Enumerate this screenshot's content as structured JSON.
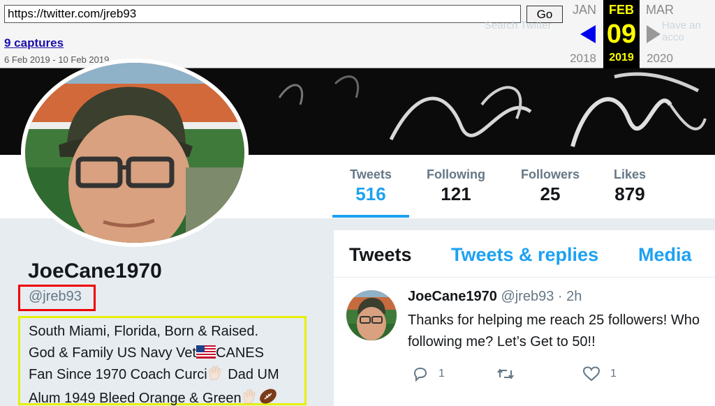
{
  "wayback": {
    "url": "https://twitter.com/jreb93",
    "go_label": "Go",
    "captures_label": "9 captures",
    "date_range": "6 Feb 2019 - 10 Feb 2019",
    "prev_month": "JAN",
    "active_month": "FEB",
    "next_month": "MAR",
    "active_day": "09",
    "prev_year": "2018",
    "active_year": "2019",
    "next_year": "2020",
    "ghost_search": "Search Twitter",
    "ghost_account": "Have an acco"
  },
  "stats": [
    {
      "label": "Tweets",
      "value": "516"
    },
    {
      "label": "Following",
      "value": "121"
    },
    {
      "label": "Followers",
      "value": "25"
    },
    {
      "label": "Likes",
      "value": "879"
    }
  ],
  "profile": {
    "name": "JoeCane1970",
    "handle": "@jreb93",
    "bio_line1": "South Miami, Florida, Born & Raised.",
    "bio_line2a": "God & Family US Navy Vet",
    "bio_line2b": "CANES",
    "bio_line3a": "Fan Since 1970 Coach Curci",
    "bio_line3b": " Dad UM",
    "bio_line4": "Alum 1949 Bleed Orange & Green"
  },
  "timeline": {
    "tabs": [
      "Tweets",
      "Tweets & replies",
      "Media"
    ],
    "tweet": {
      "name": "JoeCane1970",
      "handle": "@jreb93",
      "time": "· 2h",
      "text_line1": "Thanks for helping me reach 25 followers! Who",
      "text_line2": "following me? Let’s Get to 50!!",
      "reply_count": "1",
      "retweet_count": "",
      "like_count": "1"
    }
  },
  "colors": {
    "accent": "#1da1f2",
    "handle_box": "#ee0000",
    "bio_box": "#e6f000",
    "wayback_active": "#ffff00"
  }
}
